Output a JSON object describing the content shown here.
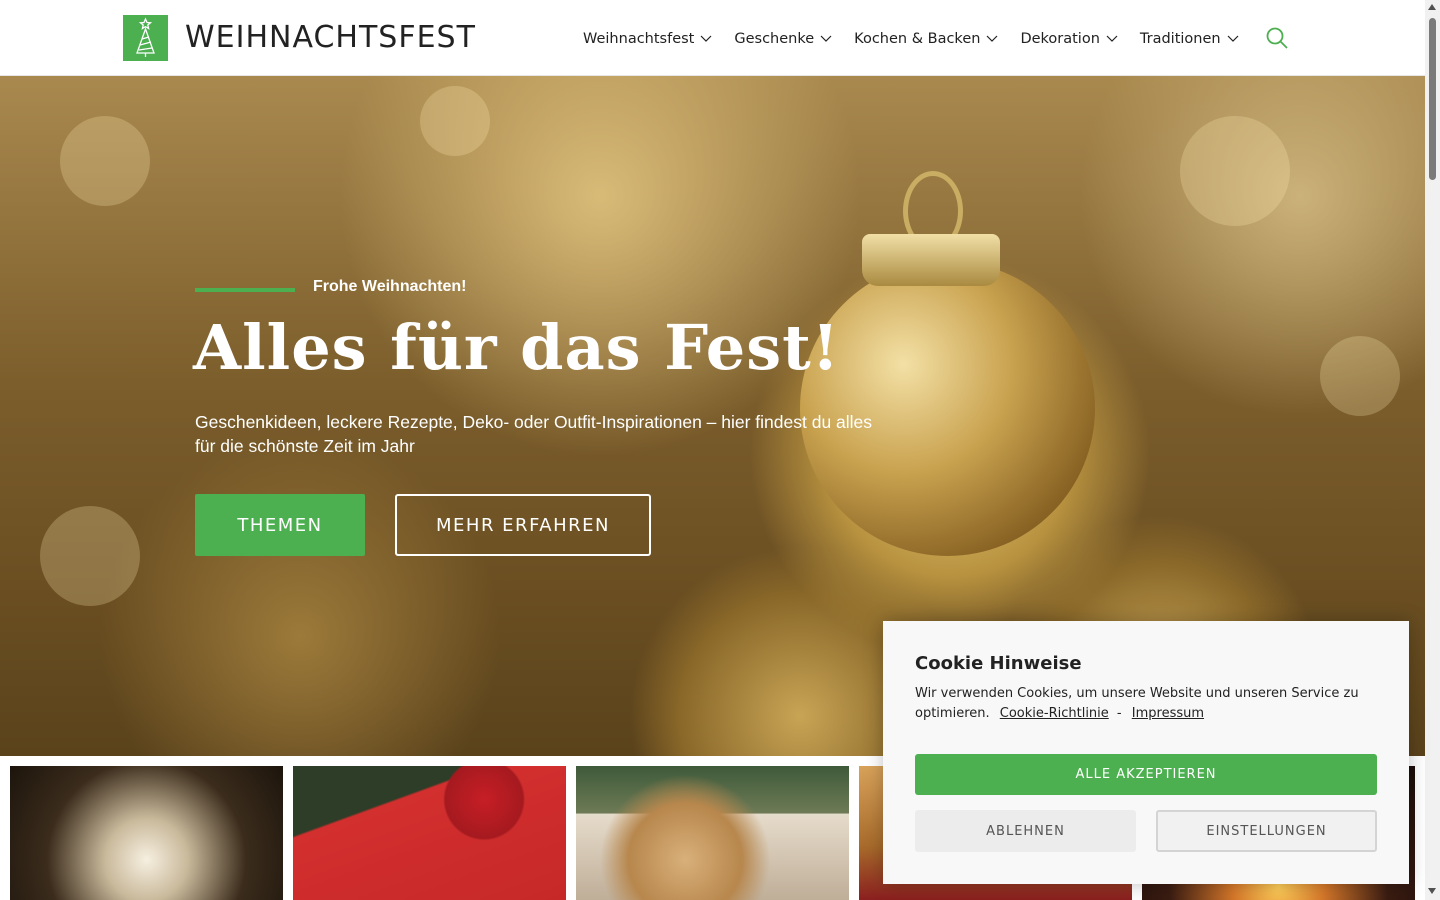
{
  "brand": {
    "name": "WEIHNACHTSFEST",
    "accent_color": "#4caf50"
  },
  "nav": {
    "items": [
      {
        "label": "Weihnachtsfest"
      },
      {
        "label": "Geschenke"
      },
      {
        "label": "Kochen & Backen"
      },
      {
        "label": "Dekoration"
      },
      {
        "label": "Traditionen"
      }
    ],
    "search_icon": "search-icon"
  },
  "hero": {
    "kicker": "Frohe Weihnachten!",
    "title": "Alles für das Fest!",
    "subtitle": "Geschenkideen, leckere Rezepte, Deko- oder Outfit-Inspirationen – hier findest du alles für die schönste Zeit im Jahr",
    "primary_button": "THEMEN",
    "secondary_button": "MEHR ERFAHREN"
  },
  "cookie": {
    "title": "Cookie Hinweise",
    "text": "Wir verwenden Cookies, um unsere Website und unseren Service zu optimieren.",
    "policy_link": "Cookie-Richtlinie",
    "separator": "-",
    "imprint_link": "Impressum",
    "accept_all": "ALLE AKZEPTIEREN",
    "decline": "ABLEHNEN",
    "settings": "EINSTELLUNGEN"
  }
}
